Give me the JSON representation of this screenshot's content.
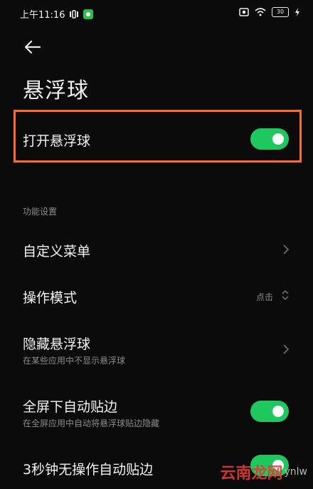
{
  "status": {
    "time": "上午11:16",
    "battery": "30"
  },
  "header": {
    "title": "悬浮球"
  },
  "highlight_row": {
    "label": "打开悬浮球",
    "toggle_on": true,
    "toggle_color": "#1fc75f",
    "highlight_color": "#ff6a2b"
  },
  "section": {
    "label": "功能设置"
  },
  "rows": [
    {
      "label": "自定义菜单"
    },
    {
      "label": "操作模式",
      "value": "点击"
    },
    {
      "label": "隐藏悬浮球",
      "sub": "在某些应用中不显示悬浮球"
    },
    {
      "label": "全屏下自动贴边",
      "sub": "在全屏应用中自动将悬浮球贴边隐藏",
      "toggle_on": true
    },
    {
      "label": "3秒钟无操作自动贴边",
      "toggle_on": true
    }
  ],
  "watermark": {
    "text": "云南龙网",
    "side": "ynlw"
  }
}
